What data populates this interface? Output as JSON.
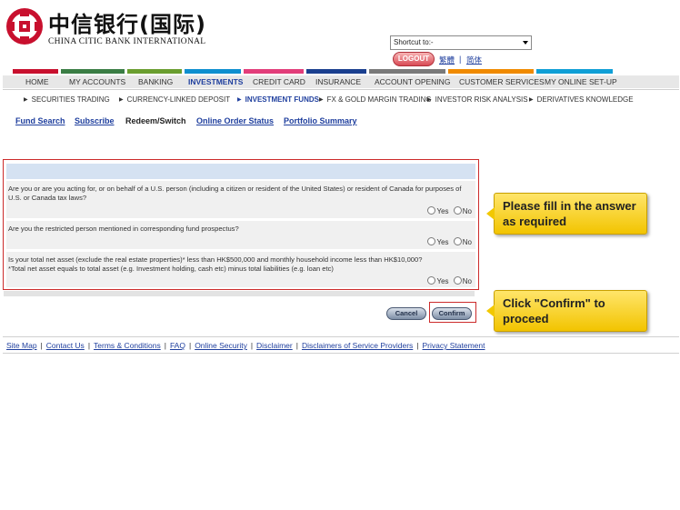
{
  "bank": {
    "name_cn": "中信银行(国际)",
    "name_en": "CHINA CITIC BANK INTERNATIONAL"
  },
  "header": {
    "shortcut_value": "Shortcut to:-",
    "logout_label": "LOGOUT",
    "lang_trad": "繁體",
    "lang_simp": "简体",
    "lang_separator": "|"
  },
  "nav": {
    "items": [
      "HOME",
      "MY ACCOUNTS",
      "BANKING",
      "INVESTMENTS",
      "CREDIT CARD",
      "INSURANCE",
      "ACCOUNT OPENING",
      "CUSTOMER SERVICES",
      "MY ONLINE SET-UP"
    ],
    "active": "INVESTMENTS",
    "stripe_colors": [
      "#c8102e",
      "#3a7d44",
      "#6a9e2f",
      "#0d8fcf",
      "#e23d7a",
      "#1a3f8f",
      "#7a7a7a",
      "#f08a00",
      "#0f9fd6"
    ]
  },
  "subnav": {
    "items": [
      "SECURITIES TRADING",
      "CURRENCY-LINKED DEPOSIT",
      "INVESTMENT FUNDS",
      "FX & GOLD MARGIN TRADING",
      "INVESTOR RISK ANALYSIS",
      "DERIVATIVES KNOWLEDGE"
    ],
    "active": "INVESTMENT FUNDS"
  },
  "tabs": {
    "fund_search": "Fund Search",
    "subscribe": "Subscribe",
    "redeem_switch": "Redeem/Switch",
    "online_order_status": "Online Order Status",
    "portfolio_summary": "Portfolio Summary"
  },
  "questions": [
    {
      "text": "Are you or are you acting for, or on behalf of a U.S. person (including a citizen or resident of the United States) or resident of Canada for purposes of U.S. or Canada tax laws?",
      "yes": "Yes",
      "no": "No"
    },
    {
      "text": "Are you the restricted person mentioned in corresponding fund prospectus?",
      "yes": "Yes",
      "no": "No"
    },
    {
      "text": "Is your total net asset (exclude the real estate properties)* less than HK$500,000 and monthly household income less than HK$10,000?",
      "note": "*Total net asset equals to total asset (e.g. Investment holding, cash etc) minus total liabilities (e.g. loan etc)",
      "yes": "Yes",
      "no": "No"
    }
  ],
  "buttons": {
    "cancel": "Cancel",
    "confirm": "Confirm"
  },
  "callouts": {
    "fill_in": "Please fill in the answer as required",
    "confirm": "Click \"Confirm\" to proceed"
  },
  "footer": {
    "links": [
      "Site Map",
      "Contact Us",
      "Terms & Conditions",
      "FAQ",
      "Online Security",
      "Disclaimer",
      "Disclaimers of Service Providers",
      "Privacy Statement"
    ],
    "separator": "|"
  },
  "colors": {
    "link": "#1f3f9e",
    "highlight_border": "#cc2b2b",
    "callout_yellow": "#f2c400",
    "form_header": "#d5e2f2"
  }
}
